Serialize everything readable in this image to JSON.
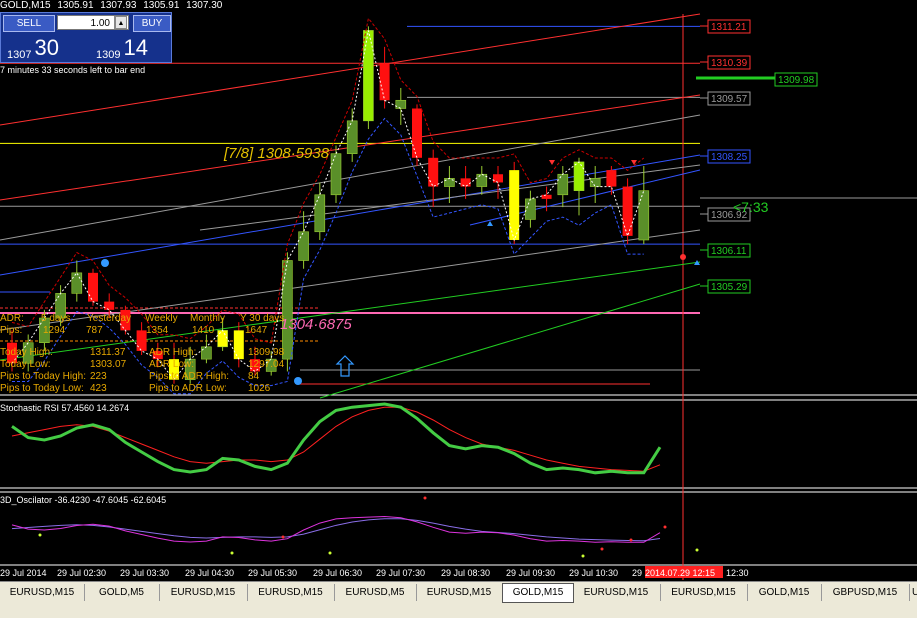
{
  "header": {
    "symbol": "GOLD,M15",
    "open": "1305.91",
    "high": "1307.93",
    "low": "1305.91",
    "close": "1307.30"
  },
  "trade_panel": {
    "sell_label": "SELL",
    "buy_label": "BUY",
    "lot": "1.00",
    "bid_prefix": "1307",
    "bid_big": "30",
    "ask_prefix": "1309",
    "ask_big": "14"
  },
  "countdown": "7 minutes 33 seconds left to bar end",
  "price_levels": [
    {
      "value": "1311.21",
      "color": "#ff3030",
      "y": 1311.21
    },
    {
      "value": "1310.39",
      "color": "#ff3030",
      "y": 1310.39
    },
    {
      "value": "1309.98",
      "color": "#22cc22",
      "y": 1309.98
    },
    {
      "value": "1309.57",
      "color": "#9a9a9a",
      "y": 1309.57
    },
    {
      "value": "1308.25",
      "color": "#3355ff",
      "y": 1308.25
    },
    {
      "value": "1306.92",
      "color": "#9a9a9a",
      "y": 1306.92
    },
    {
      "value": "1306.11",
      "color": "#22cc22",
      "y": 1306.11
    },
    {
      "value": "1305.29",
      "color": "#22cc22",
      "y": 1305.29
    }
  ],
  "labels": {
    "fib_high": "[7/8]  1308·5938",
    "fib_low": "1304·6875",
    "timer": "<7:33"
  },
  "adr_table": {
    "row1": [
      "ADR:",
      "5 days",
      "Yesterday",
      "Weekly",
      "Monthly",
      "Y 30 days"
    ],
    "row2": [
      "Pips:",
      "1294",
      "787",
      "1354",
      "1410",
      "1647"
    ],
    "stats": [
      [
        "Today High:",
        "1311.37",
        "ADR High:",
        "1309.98"
      ],
      [
        "Today Low:",
        "1303.07",
        "ADR Low:",
        "1297.04"
      ],
      [
        "Pips to Today High:",
        "223",
        "Pips to ADR High:",
        "84"
      ],
      [
        "Pips to Today Low:",
        "423",
        "Pips to ADR Low:",
        "1026"
      ]
    ]
  },
  "indicators": {
    "stoch_title": "Stochastic RSI 57.4560 14.2674",
    "osc_title": "3D_Oscilator -36.4230 -47.6045 -62.6045"
  },
  "time_axis": {
    "labels": [
      "29 Jul 2014",
      "29 Jul 02:30",
      "29 Jul 03:30",
      "29 Jul 04:30",
      "29 Jul 05:30",
      "29 Jul 06:30",
      "29 Jul 07:30",
      "29 Jul 08:30",
      "29 Jul 09:30",
      "29 Jul 10:30",
      "29",
      "2014.07.29 12:15",
      "12:30"
    ]
  },
  "tabs": [
    "EURUSD,M15",
    "GOLD,M5",
    "EURUSD,M15",
    "EURUSD,M15",
    "EURUSD,M5",
    "EURUSD,M15",
    "GOLD,M15",
    "EURUSD,M15",
    "EURUSD,M15",
    "GOLD,M15",
    "GBPUSD,M15",
    "US"
  ],
  "active_tab": 6,
  "chart_data": {
    "type": "candlestick",
    "symbol": "GOLD,M15",
    "candles": [
      {
        "o": 1303.6,
        "h": 1303.9,
        "c": 1303.1,
        "l": 1302.9,
        "bull": false
      },
      {
        "o": 1303.1,
        "h": 1303.8,
        "c": 1303.6,
        "l": 1302.9,
        "bull": true
      },
      {
        "o": 1303.6,
        "h": 1304.4,
        "c": 1304.2,
        "l": 1303.4,
        "bull": true
      },
      {
        "o": 1304.2,
        "h": 1305.0,
        "c": 1304.8,
        "l": 1304.0,
        "bull": true
      },
      {
        "o": 1304.8,
        "h": 1305.6,
        "c": 1305.3,
        "l": 1304.6,
        "bull": true
      },
      {
        "o": 1305.3,
        "h": 1305.4,
        "c": 1304.6,
        "l": 1304.5,
        "bull": false
      },
      {
        "o": 1304.6,
        "h": 1304.8,
        "c": 1304.4,
        "l": 1304.2,
        "bull": false
      },
      {
        "o": 1304.4,
        "h": 1304.5,
        "c": 1303.9,
        "l": 1303.8,
        "bull": false
      },
      {
        "o": 1303.9,
        "h": 1304.1,
        "c": 1303.4,
        "l": 1303.3,
        "bull": false
      },
      {
        "o": 1303.4,
        "h": 1303.6,
        "c": 1303.2,
        "l": 1303.0,
        "bull": false
      },
      {
        "o": 1303.2,
        "h": 1303.6,
        "c": 1302.7,
        "l": 1302.6,
        "bull": false,
        "yellow": true
      },
      {
        "o": 1302.7,
        "h": 1303.5,
        "c": 1303.2,
        "l": 1302.6,
        "bull": true
      },
      {
        "o": 1303.2,
        "h": 1303.8,
        "c": 1303.5,
        "l": 1303.1,
        "bull": true
      },
      {
        "o": 1303.5,
        "h": 1304.2,
        "c": 1303.9,
        "l": 1303.4,
        "bull": true,
        "yellow": true
      },
      {
        "o": 1303.9,
        "h": 1304.1,
        "c": 1303.2,
        "l": 1303.0,
        "bull": false,
        "yellow": true
      },
      {
        "o": 1303.2,
        "h": 1303.5,
        "c": 1302.9,
        "l": 1302.8,
        "bull": false
      },
      {
        "o": 1302.9,
        "h": 1303.4,
        "c": 1303.2,
        "l": 1302.8,
        "bull": true
      },
      {
        "o": 1303.2,
        "h": 1305.8,
        "c": 1305.6,
        "l": 1302.9,
        "bull": true
      },
      {
        "o": 1305.6,
        "h": 1306.8,
        "c": 1306.3,
        "l": 1305.4,
        "bull": true
      },
      {
        "o": 1306.3,
        "h": 1307.5,
        "c": 1307.2,
        "l": 1306.1,
        "bull": true
      },
      {
        "o": 1307.2,
        "h": 1308.4,
        "c": 1308.2,
        "l": 1307.0,
        "bull": true
      },
      {
        "o": 1308.2,
        "h": 1309.3,
        "c": 1309.0,
        "l": 1308.0,
        "bull": true
      },
      {
        "o": 1309.0,
        "h": 1311.3,
        "c": 1311.2,
        "l": 1308.8,
        "bull": true,
        "lime": true
      },
      {
        "o": 1310.4,
        "h": 1310.8,
        "c": 1309.5,
        "l": 1309.3,
        "bull": false
      },
      {
        "o": 1309.5,
        "h": 1309.8,
        "c": 1309.3,
        "l": 1308.9,
        "bull": true
      },
      {
        "o": 1309.3,
        "h": 1309.4,
        "c": 1308.1,
        "l": 1307.9,
        "bull": false
      },
      {
        "o": 1308.1,
        "h": 1308.3,
        "c": 1307.4,
        "l": 1306.9,
        "bull": false
      },
      {
        "o": 1307.4,
        "h": 1307.9,
        "c": 1307.6,
        "l": 1307.0,
        "bull": true
      },
      {
        "o": 1307.6,
        "h": 1307.9,
        "c": 1307.4,
        "l": 1307.1,
        "bull": false
      },
      {
        "o": 1307.4,
        "h": 1307.9,
        "c": 1307.7,
        "l": 1307.2,
        "bull": true
      },
      {
        "o": 1307.7,
        "h": 1307.9,
        "c": 1307.5,
        "l": 1307.1,
        "bull": false
      },
      {
        "o": 1307.8,
        "h": 1308.0,
        "c": 1306.1,
        "l": 1306.0,
        "bull": false,
        "yellow": true
      },
      {
        "o": 1306.6,
        "h": 1307.3,
        "c": 1307.1,
        "l": 1306.4,
        "bull": true
      },
      {
        "o": 1307.1,
        "h": 1307.4,
        "c": 1307.2,
        "l": 1306.8,
        "bull": false
      },
      {
        "o": 1307.2,
        "h": 1307.9,
        "c": 1307.7,
        "l": 1306.9,
        "bull": true
      },
      {
        "o": 1307.3,
        "h": 1308.1,
        "c": 1308.0,
        "l": 1306.7,
        "bull": true,
        "lime": true
      },
      {
        "o": 1307.6,
        "h": 1307.9,
        "c": 1307.4,
        "l": 1307.0,
        "bull": true
      },
      {
        "o": 1307.8,
        "h": 1307.9,
        "c": 1307.4,
        "l": 1307.2,
        "bull": false
      },
      {
        "o": 1307.4,
        "h": 1307.6,
        "c": 1306.2,
        "l": 1306.0,
        "bull": false
      },
      {
        "o": 1306.1,
        "h": 1307.9,
        "c": 1307.3,
        "l": 1306.0,
        "bull": true
      }
    ],
    "price_range": [
      1302.4,
      1311.6
    ],
    "stoch_rsi": [
      72,
      58,
      55,
      60,
      70,
      74,
      68,
      52,
      40,
      28,
      18,
      15,
      18,
      32,
      30,
      22,
      18,
      26,
      55,
      78,
      92,
      96,
      98,
      100,
      96,
      82,
      64,
      48,
      44,
      48,
      46,
      38,
      26,
      18,
      20,
      18,
      14,
      16,
      14,
      14,
      46
    ],
    "stoch_signal": [
      60,
      64,
      68,
      72,
      74,
      72,
      66,
      58,
      50,
      42,
      34,
      28,
      26,
      28,
      30,
      30,
      28,
      30,
      40,
      56,
      72,
      84,
      92,
      96,
      96,
      90,
      80,
      68,
      58,
      50,
      46,
      42,
      36,
      30,
      26,
      22,
      20,
      18,
      17,
      16,
      24
    ]
  }
}
